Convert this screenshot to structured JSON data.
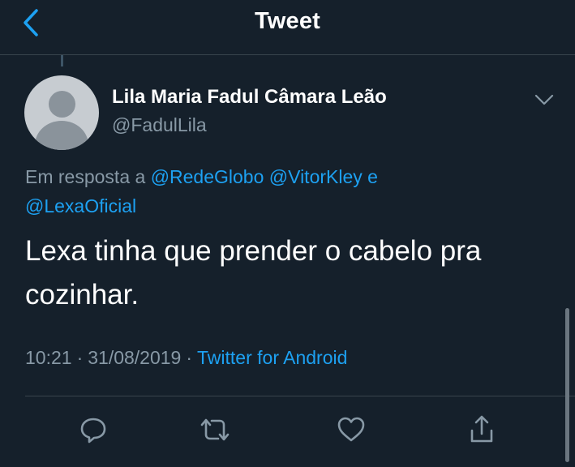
{
  "header": {
    "title": "Tweet"
  },
  "tweet": {
    "author": {
      "display_name": "Lila Maria Fadul Câmara Leão",
      "handle": "@FadulLila"
    },
    "reply": {
      "prefix": "Em resposta a",
      "mention_1": "@RedeGlobo",
      "mention_2": "@VitorKley",
      "joiner": "e",
      "mention_3": "@LexaOficial"
    },
    "text_line_1": "Lexa tinha que prender o cabelo pra",
    "text_line_2": "cozinhar.",
    "meta": {
      "time": "10:21",
      "separator": "·",
      "date": "31/08/2019",
      "source": "Twitter for Android"
    }
  },
  "colors": {
    "background": "#15202b",
    "accent": "#1da1f2",
    "secondary_text": "#8899a6",
    "divider": "#38444d"
  },
  "icons": {
    "back": "chevron-left-icon",
    "more": "chevron-down-icon",
    "reply": "reply-icon",
    "retweet": "retweet-icon",
    "like": "heart-icon",
    "share": "share-icon"
  }
}
